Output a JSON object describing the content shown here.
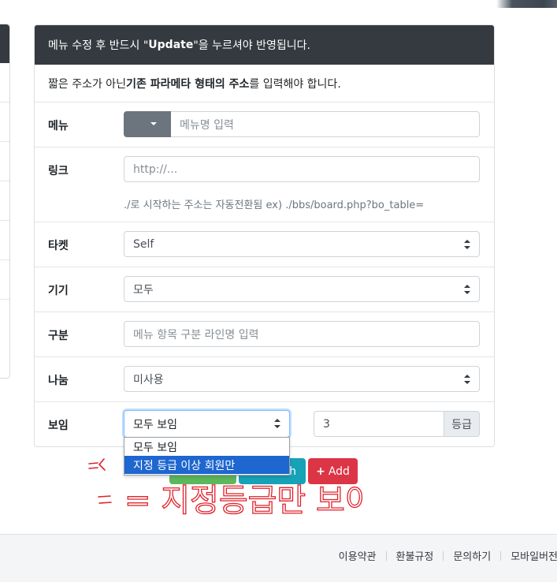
{
  "header": {
    "notice_prefix": "메뉴 수정 후 반드시 \"",
    "notice_bold": "Update",
    "notice_suffix": "\"을 누르셔야 반영됩니다."
  },
  "info": {
    "prefix": "짧은 주소가 아닌 ",
    "bold": "기존 파라메타 형태의 주소",
    "suffix": "를 입력해야 합니다."
  },
  "form": {
    "menu": {
      "label": "메뉴",
      "placeholder": "메뉴명 입력"
    },
    "link": {
      "label": "링크",
      "placeholder": "http://...",
      "help": "./로 시작하는 주소는 자동전환됨 ex) ./bbs/board.php?bo_table="
    },
    "target": {
      "label": "타켓",
      "value": "Self"
    },
    "device": {
      "label": "기기",
      "value": "모두"
    },
    "division": {
      "label": "구분",
      "placeholder": "메뉴 항목 구분 라인명 입력"
    },
    "split": {
      "label": "나눔",
      "value": "미사용"
    },
    "visibility": {
      "label": "보임",
      "value": "모두 보임",
      "grade_value": "3",
      "grade_addon": "등급",
      "options": [
        "모두 보임",
        "지정 등급 이상 회원만"
      ],
      "highlighted_index": 1
    }
  },
  "buttons": {
    "teal_partial_label": "h",
    "add_label": "Add",
    "add_icon": "plus-icon"
  },
  "annotation": {
    "handwritten": "= 지정등급만 보이기"
  },
  "footer": {
    "links": [
      "이용약관",
      "환불규정",
      "문의하기",
      "모바일버전"
    ]
  },
  "colors": {
    "header_bg": "#343a40",
    "add_button": "#dc3545",
    "highlight": "#1e66d0"
  }
}
